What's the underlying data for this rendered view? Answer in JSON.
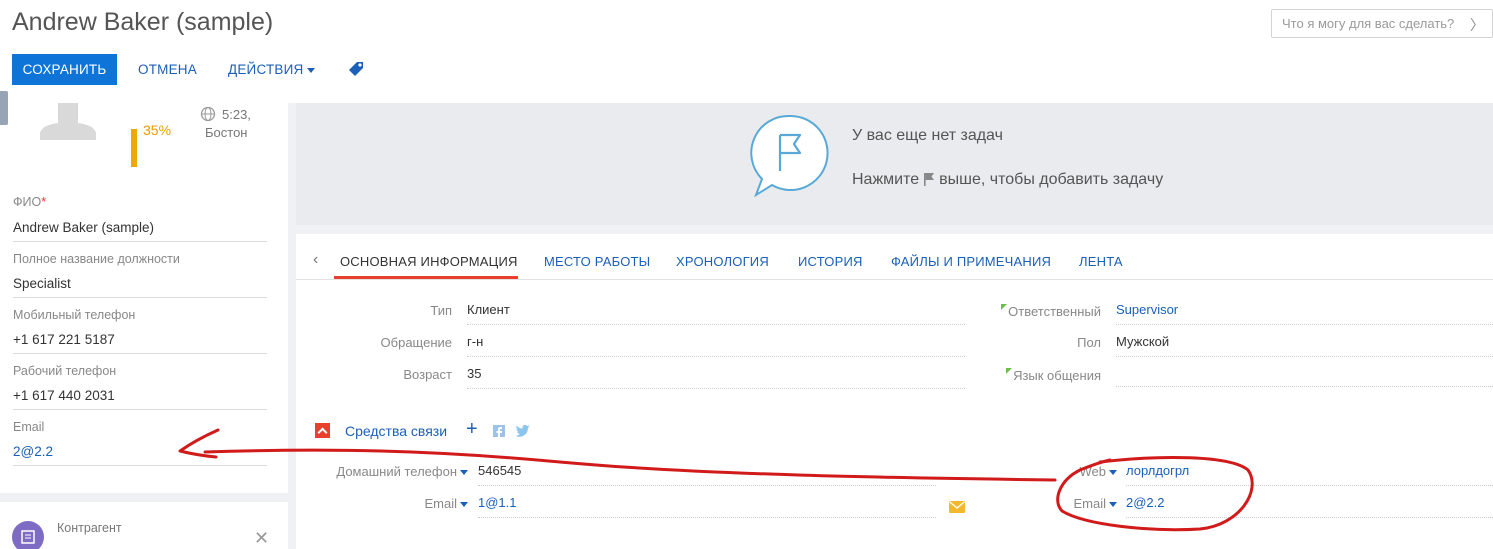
{
  "header": {
    "title": "Andrew Baker (sample)",
    "search_placeholder": "Что я могу для вас сделать?",
    "search_chevron": "〉"
  },
  "toolbar": {
    "save_label": "СОХРАНИТЬ",
    "cancel_label": "ОТМЕНА",
    "actions_label": "ДЕЙСТВИЯ"
  },
  "profile": {
    "completeness": "35%",
    "completeness_value": 0.35,
    "time": "5:23,",
    "city": "Бостон"
  },
  "left_fields": [
    {
      "label": "ФИО",
      "required": "*",
      "value": "Andrew Baker (sample)"
    },
    {
      "label": "Полное название должности",
      "value": "Specialist"
    },
    {
      "label": "Мобильный телефон",
      "value": "+1 617 221 5187"
    },
    {
      "label": "Рабочий телефон",
      "value": "+1 617 440 2031"
    },
    {
      "label": "Email",
      "value": "2@2.2"
    }
  ],
  "account_card": {
    "label": "Контрагент",
    "close": "✕"
  },
  "tasks": {
    "title": "У вас еще нет задач",
    "hint_before": "Нажмите",
    "hint_after": "выше, чтобы добавить задачу"
  },
  "tabs": {
    "prev": "‹",
    "items": [
      "ОСНОВНАЯ ИНФОРМАЦИЯ",
      "МЕСТО РАБОТЫ",
      "ХРОНОЛОГИЯ",
      "ИСТОРИЯ",
      "ФАЙЛЫ И ПРИМЕЧАНИЯ",
      "ЛЕНТА"
    ]
  },
  "main_fields": {
    "type": {
      "label": "Тип",
      "value": "Клиент"
    },
    "salutation": {
      "label": "Обращение",
      "value": "г-н"
    },
    "age": {
      "label": "Возраст",
      "value": "35"
    },
    "owner": {
      "label": "Ответственный",
      "value": "Supervisor"
    },
    "gender": {
      "label": "Пол",
      "value": "Мужской"
    },
    "language": {
      "label": "Язык общения",
      "value": ""
    }
  },
  "communications": {
    "section_title": "Средства связи",
    "add": "+",
    "home_phone": {
      "label": "Домашний телефон",
      "value": "546545"
    },
    "email1": {
      "label": "Email",
      "value": "1@1.1"
    },
    "web": {
      "label": "Web",
      "value": "лорлдогрл"
    },
    "email2": {
      "label": "Email",
      "value": "2@2.2"
    }
  },
  "colors": {
    "primary": "#0f74d8",
    "link": "#1a5fb8",
    "accent_red": "#e8402c",
    "progress": "#efa800",
    "annotation": "#d11a1a"
  },
  "icons": [
    "tag-icon",
    "avatar-icon",
    "globe-clock-icon",
    "flag-bubble-icon",
    "flag-icon",
    "facebook-icon",
    "twitter-icon",
    "mail-icon",
    "account-icon",
    "close-icon"
  ]
}
